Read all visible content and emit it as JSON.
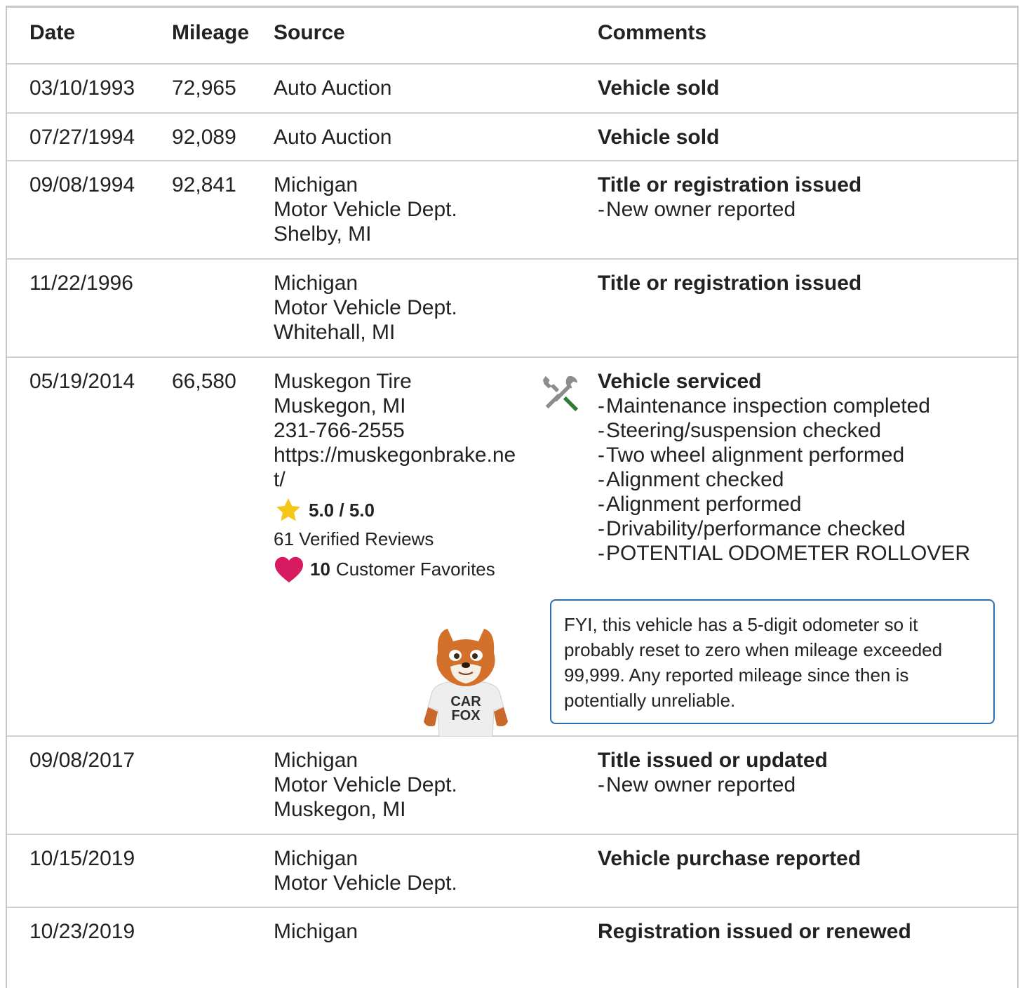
{
  "headers": {
    "date": "Date",
    "mileage": "Mileage",
    "source": "Source",
    "comments": "Comments"
  },
  "rows": [
    {
      "date": "03/10/1993",
      "mileage": "72,965",
      "source": [
        "Auto Auction"
      ],
      "comment_title": "Vehicle sold",
      "details": []
    },
    {
      "date": "07/27/1994",
      "mileage": "92,089",
      "source": [
        "Auto Auction"
      ],
      "comment_title": "Vehicle sold",
      "details": []
    },
    {
      "date": "09/08/1994",
      "mileage": "92,841",
      "source": [
        "Michigan",
        "Motor Vehicle Dept.",
        "Shelby, MI"
      ],
      "comment_title": "Title or registration issued",
      "details": [
        "New owner reported"
      ]
    },
    {
      "date": "11/22/1996",
      "mileage": "",
      "source": [
        "Michigan",
        "Motor Vehicle Dept.",
        "Whitehall, MI"
      ],
      "comment_title": "Title or registration issued",
      "details": []
    },
    {
      "date": "05/19/2014",
      "mileage": "66,580",
      "source": [
        "Muskegon Tire",
        "Muskegon, MI",
        "231-766-2555",
        "https://muskegonbrake.net/"
      ],
      "rating": "5.0 / 5.0",
      "reviews": "61 Verified Reviews",
      "favorites_count": "10",
      "favorites_label": "Customer Favorites",
      "comment_title": "Vehicle serviced",
      "details": [
        "Maintenance inspection completed",
        "Steering/suspension checked",
        "Two wheel alignment performed",
        "Alignment checked",
        "Alignment performed",
        "Drivability/performance checked",
        "POTENTIAL ODOMETER ROLLOVER"
      ],
      "fyi": "FYI, this vehicle has a 5-digit odometer so it probably reset to zero when mileage exceeded 99,999. Any reported mileage since then is potentially unreliable.",
      "mascot_text": [
        "CAR",
        "FOX"
      ]
    },
    {
      "date": "09/08/2017",
      "mileage": "",
      "source": [
        "Michigan",
        "Motor Vehicle Dept.",
        "Muskegon, MI"
      ],
      "comment_title": "Title issued or updated",
      "details": [
        "New owner reported"
      ]
    },
    {
      "date": "10/15/2019",
      "mileage": "",
      "source": [
        "Michigan",
        "Motor Vehicle Dept."
      ],
      "comment_title": "Vehicle purchase reported",
      "details": []
    },
    {
      "date": "10/23/2019",
      "mileage": "",
      "source": [
        "Michigan"
      ],
      "comment_title": "Registration issued or renewed",
      "details": []
    }
  ],
  "icons": {
    "service": "wrench-screwdriver-icon",
    "star": "star-icon",
    "heart": "heart-icon"
  },
  "colors": {
    "star": "#f5c518",
    "heart": "#d81b60",
    "fyi_border": "#2a6fb0",
    "service_green": "#2e7d32"
  }
}
